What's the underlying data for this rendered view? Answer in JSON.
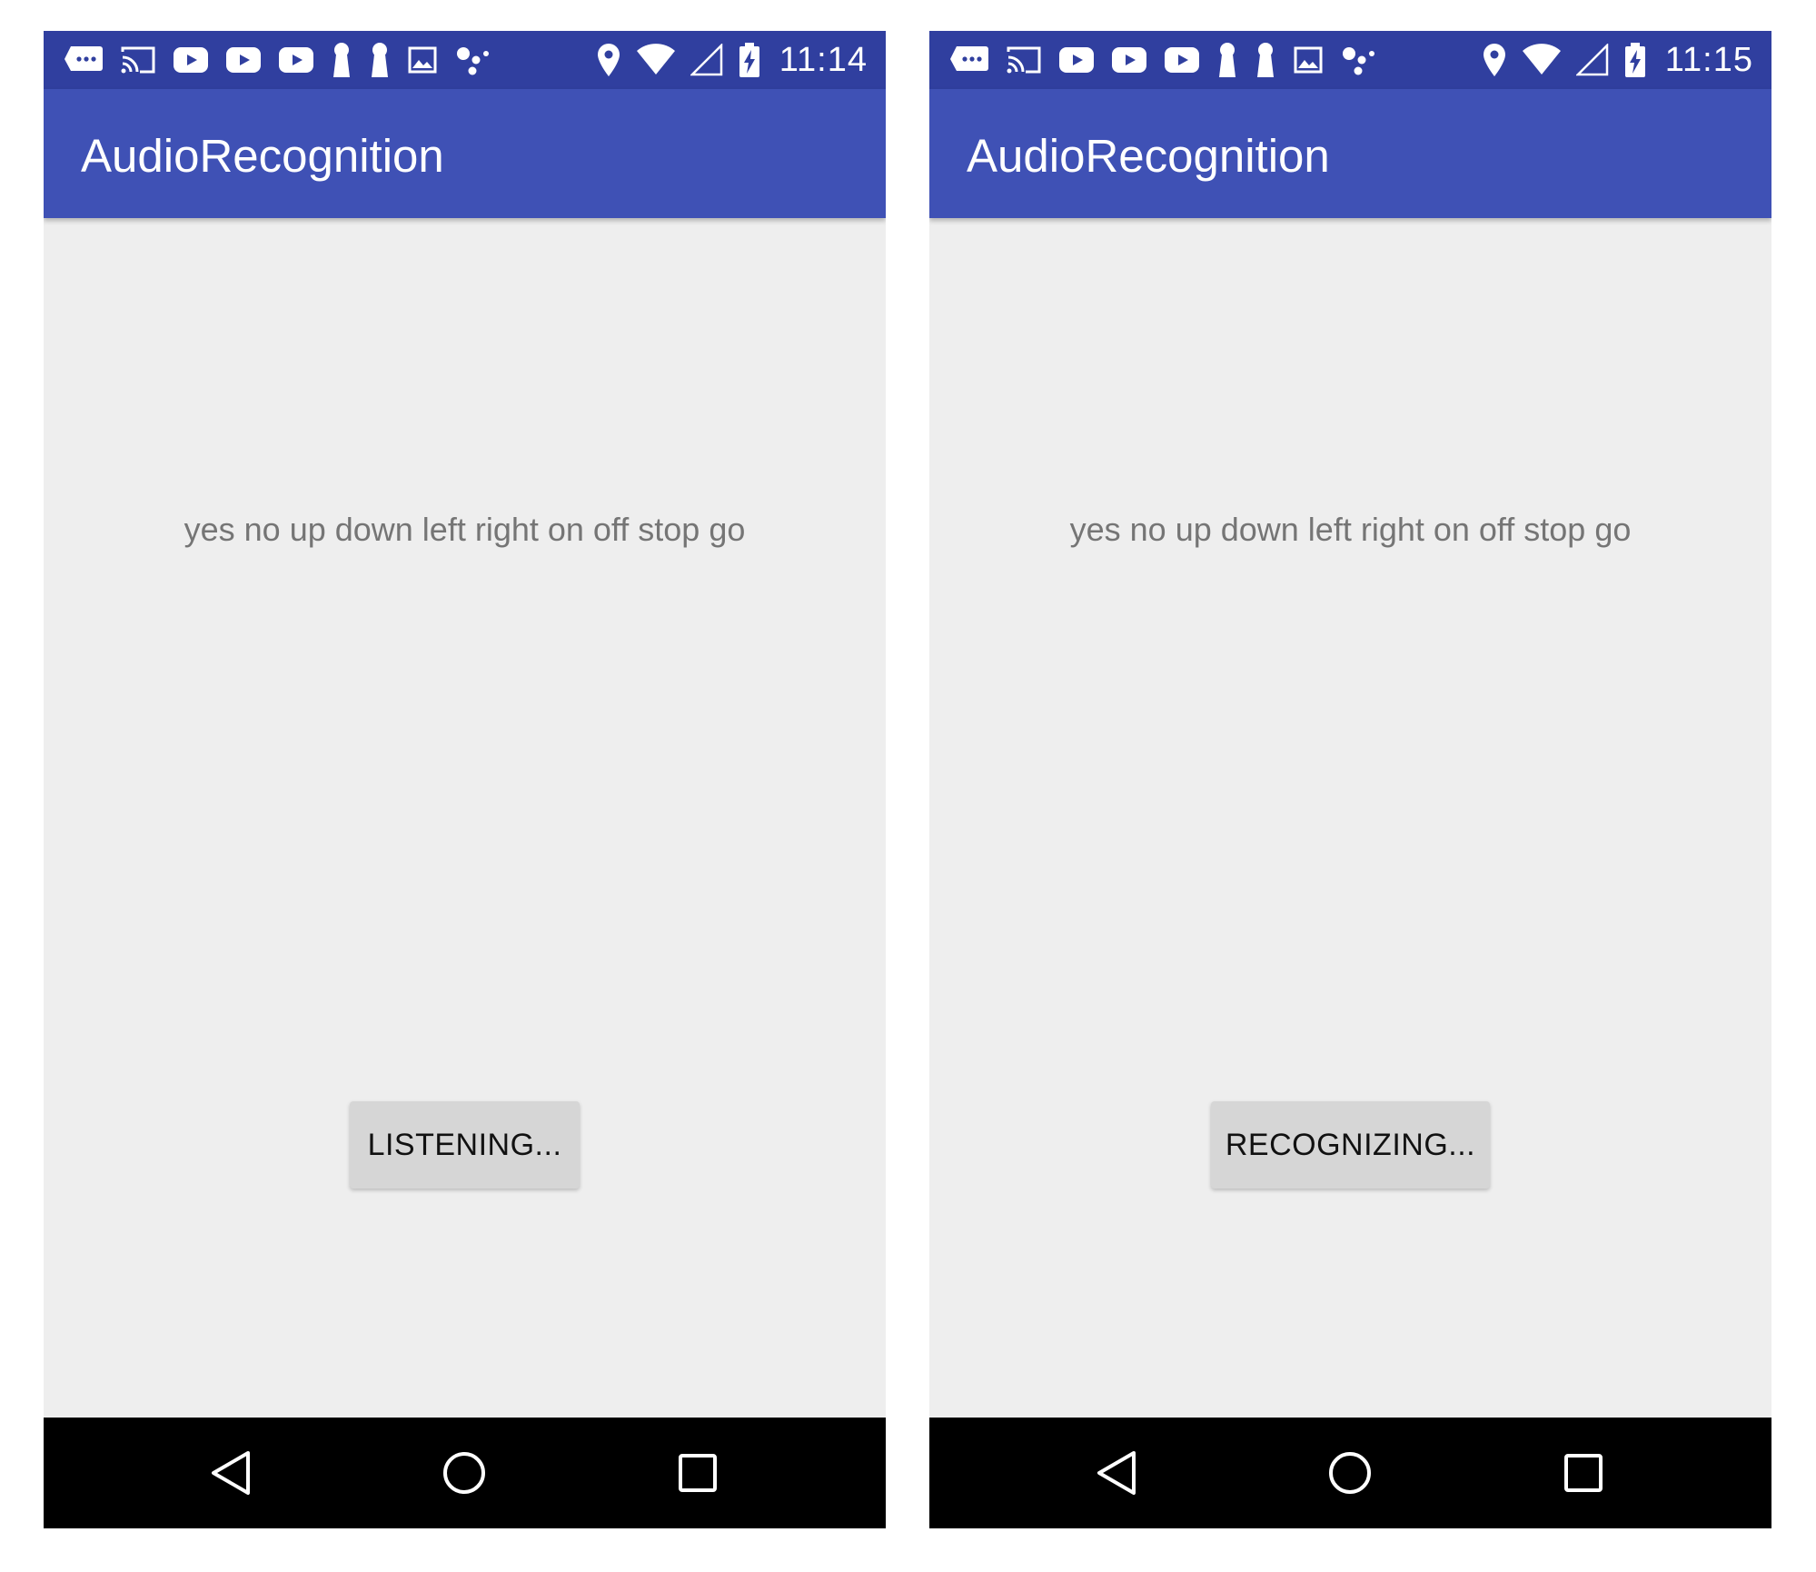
{
  "colors": {
    "status_bar": "#303f9f",
    "app_bar": "#3f51b5",
    "content_bg": "#eeeeee",
    "label_text": "#757575",
    "button_bg": "#d6d6d6",
    "nav_bar": "#000000"
  },
  "screens": [
    {
      "status_bar": {
        "time": "11:14",
        "icons": [
          "messages-icon",
          "cast-icon",
          "youtube-icon",
          "youtube-icon",
          "youtube-icon",
          "keyhole-icon",
          "keyhole-icon",
          "image-icon",
          "dots-icon",
          "location-icon",
          "wifi-icon",
          "cell-signal-icon",
          "battery-charging-icon"
        ]
      },
      "app_bar": {
        "title": "AudioRecognition"
      },
      "label": "yes no up down left right on off stop go",
      "button": {
        "label": "LISTENING..."
      },
      "nav": {
        "icons": [
          "back-icon",
          "home-icon",
          "recents-icon"
        ]
      }
    },
    {
      "status_bar": {
        "time": "11:15",
        "icons": [
          "messages-icon",
          "cast-icon",
          "youtube-icon",
          "youtube-icon",
          "youtube-icon",
          "keyhole-icon",
          "keyhole-icon",
          "image-icon",
          "dots-icon",
          "location-icon",
          "wifi-icon",
          "cell-signal-icon",
          "battery-charging-icon"
        ]
      },
      "app_bar": {
        "title": "AudioRecognition"
      },
      "label": "yes no up down left right on off stop go",
      "button": {
        "label": "RECOGNIZING..."
      },
      "nav": {
        "icons": [
          "back-icon",
          "home-icon",
          "recents-icon"
        ]
      }
    }
  ]
}
